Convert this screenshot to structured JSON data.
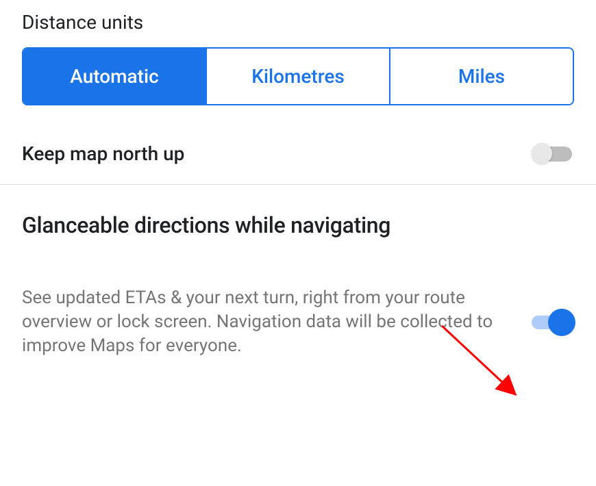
{
  "distance_units": {
    "title": "Distance units",
    "options": [
      "Automatic",
      "Kilometres",
      "Miles"
    ],
    "selected": 0
  },
  "keep_north": {
    "label": "Keep map north up",
    "enabled": false
  },
  "glanceable": {
    "heading": "Glanceable directions while navigating",
    "description": "See updated ETAs & your next turn, right from your route overview or lock screen. Navigation data will be collected to improve Maps for everyone.",
    "enabled": true
  },
  "colors": {
    "primary": "#1a73e8",
    "primary_light": "#aecbfa"
  }
}
